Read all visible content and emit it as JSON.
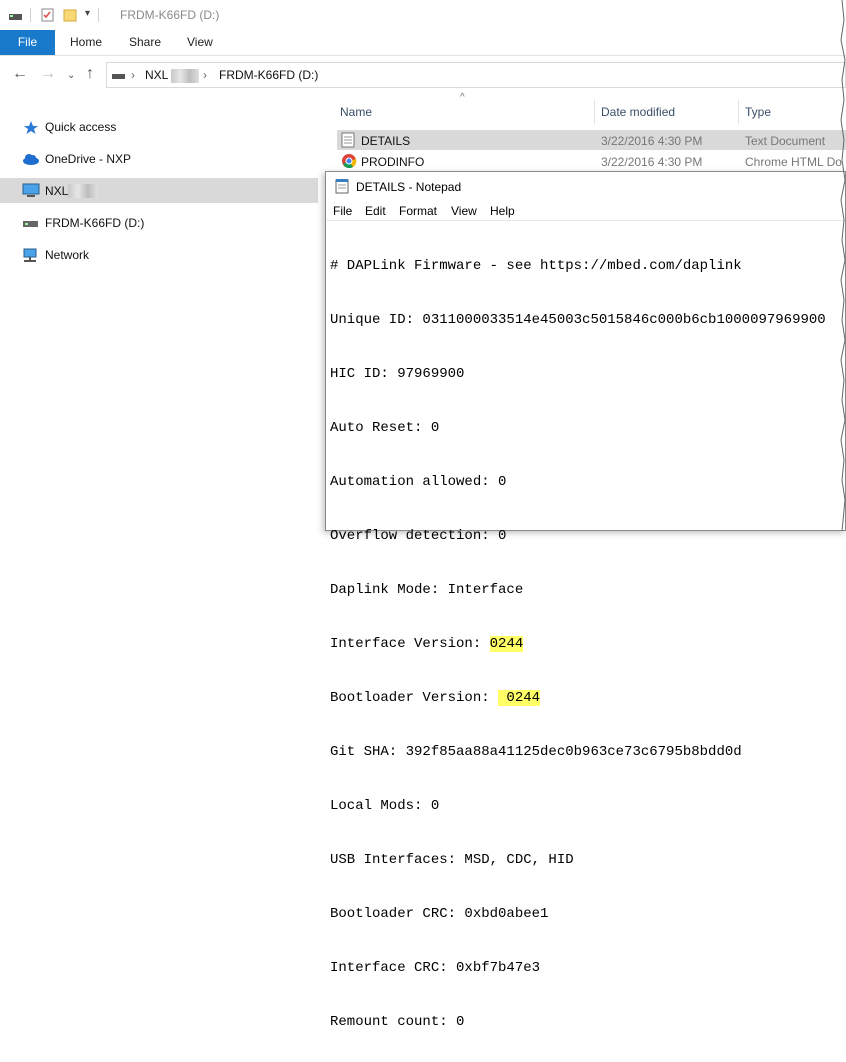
{
  "window": {
    "title": "FRDM-K66FD (D:)"
  },
  "ribbon": {
    "tabs": [
      "File",
      "Home",
      "Share",
      "View"
    ]
  },
  "address": {
    "segments": [
      "NXL",
      "FRDM-K66FD (D:)"
    ]
  },
  "nav": {
    "items": [
      {
        "label": "Quick access",
        "icon": "star-icon"
      },
      {
        "label": "OneDrive - NXP",
        "icon": "cloud-icon"
      },
      {
        "label": "NXL",
        "icon": "computer-icon"
      },
      {
        "label": "FRDM-K66FD (D:)",
        "icon": "drive-icon"
      },
      {
        "label": "Network",
        "icon": "network-icon"
      }
    ]
  },
  "filelist": {
    "columns": [
      "Name",
      "Date modified",
      "Type"
    ],
    "rows": [
      {
        "name": "DETAILS",
        "date": "3/22/2016 4:30 PM",
        "type": "Text Document"
      },
      {
        "name": "PRODINFO",
        "date": "3/22/2016 4:30 PM",
        "type": "Chrome HTML Do"
      }
    ]
  },
  "notepad": {
    "title": "DETAILS - Notepad",
    "menu": [
      "File",
      "Edit",
      "Format",
      "View",
      "Help"
    ],
    "lines": [
      "# DAPLink Firmware - see https://mbed.com/daplink",
      "Unique ID: 0311000033514e45003c5015846c000b6cb1000097969900",
      "HIC ID: 97969900",
      "Auto Reset: 0",
      "Automation allowed: 0",
      "Overflow detection: 0",
      "Daplink Mode: Interface",
      "Interface Version: ",
      "Bootloader Version: ",
      "Git SHA: 392f85aa88a41125dec0b963ce73c6795b8bdd0d",
      "Local Mods: 0",
      "USB Interfaces: MSD, CDC, HID",
      "Bootloader CRC: 0xbd0abee1",
      "Interface CRC: 0xbf7b47e3",
      "Remount count: 0"
    ],
    "highlight": {
      "interface_version": "0244",
      "bootloader_version": " 0244"
    }
  },
  "colors": {
    "file_tab": "#1979ca",
    "selection": "#d9d9d9",
    "highlight": "#ffff66"
  }
}
